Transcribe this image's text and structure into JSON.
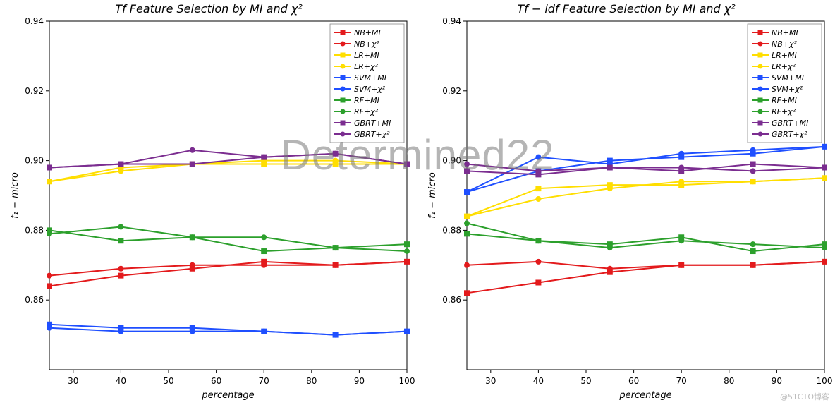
{
  "watermark": "Determined22",
  "footer_tag": "@51CTO博客",
  "chart_data": [
    {
      "type": "line",
      "title": "Tf Feature Selection by MI and χ²",
      "xlabel": "percentage",
      "ylabel": "f₁ − micro",
      "xlim": [
        25,
        100
      ],
      "ylim": [
        0.84,
        0.94
      ],
      "xticks": [
        30,
        40,
        50,
        60,
        70,
        80,
        90,
        100
      ],
      "yticks": [
        0.86,
        0.88,
        0.9,
        0.92,
        0.94
      ],
      "x": [
        25,
        40,
        55,
        70,
        85,
        100
      ],
      "legend_position": "upper-right",
      "series": [
        {
          "name": "NB+MI",
          "marker": "s",
          "color": "#e31a1c",
          "values": [
            0.864,
            0.867,
            0.869,
            0.871,
            0.87,
            0.871
          ]
        },
        {
          "name": "NB+χ²",
          "marker": "o",
          "color": "#e31a1c",
          "values": [
            0.867,
            0.869,
            0.87,
            0.87,
            0.87,
            0.871
          ]
        },
        {
          "name": "LR+MI",
          "marker": "s",
          "color": "#ffde00",
          "values": [
            0.894,
            0.898,
            0.899,
            0.899,
            0.899,
            0.899
          ]
        },
        {
          "name": "LR+χ²",
          "marker": "o",
          "color": "#ffde00",
          "values": [
            0.894,
            0.897,
            0.899,
            0.9,
            0.9,
            0.899
          ]
        },
        {
          "name": "SVM+MI",
          "marker": "s",
          "color": "#1f4fff",
          "values": [
            0.853,
            0.852,
            0.852,
            0.851,
            0.85,
            0.851
          ]
        },
        {
          "name": "SVM+χ²",
          "marker": "o",
          "color": "#1f4fff",
          "values": [
            0.852,
            0.851,
            0.851,
            0.851,
            0.85,
            0.851
          ]
        },
        {
          "name": "RF+MI",
          "marker": "s",
          "color": "#2ca02c",
          "values": [
            0.88,
            0.877,
            0.878,
            0.874,
            0.875,
            0.876
          ]
        },
        {
          "name": "RF+χ²",
          "marker": "o",
          "color": "#2ca02c",
          "values": [
            0.879,
            0.881,
            0.878,
            0.878,
            0.875,
            0.874
          ]
        },
        {
          "name": "GBRT+MI",
          "marker": "s",
          "color": "#7b2d90",
          "values": [
            0.898,
            0.899,
            0.899,
            0.901,
            0.902,
            0.899
          ]
        },
        {
          "name": "GBRT+χ²",
          "marker": "o",
          "color": "#7b2d90",
          "values": [
            0.898,
            0.899,
            0.903,
            0.901,
            0.902,
            0.899
          ]
        }
      ]
    },
    {
      "type": "line",
      "title": "Tf − idf Feature Selection by MI and χ²",
      "xlabel": "percentage",
      "ylabel": "f₁ − micro",
      "xlim": [
        25,
        100
      ],
      "ylim": [
        0.84,
        0.94
      ],
      "xticks": [
        30,
        40,
        50,
        60,
        70,
        80,
        90,
        100
      ],
      "yticks": [
        0.86,
        0.88,
        0.9,
        0.92,
        0.94
      ],
      "x": [
        25,
        40,
        55,
        70,
        85,
        100
      ],
      "legend_position": "upper-right",
      "series": [
        {
          "name": "NB+MI",
          "marker": "s",
          "color": "#e31a1c",
          "values": [
            0.862,
            0.865,
            0.868,
            0.87,
            0.87,
            0.871
          ]
        },
        {
          "name": "NB+χ²",
          "marker": "o",
          "color": "#e31a1c",
          "values": [
            0.87,
            0.871,
            0.869,
            0.87,
            0.87,
            0.871
          ]
        },
        {
          "name": "LR+MI",
          "marker": "s",
          "color": "#ffde00",
          "values": [
            0.884,
            0.892,
            0.893,
            0.893,
            0.894,
            0.895
          ]
        },
        {
          "name": "LR+χ²",
          "marker": "o",
          "color": "#ffde00",
          "values": [
            0.884,
            0.889,
            0.892,
            0.894,
            0.894,
            0.895
          ]
        },
        {
          "name": "SVM+MI",
          "marker": "s",
          "color": "#1f4fff",
          "values": [
            0.891,
            0.897,
            0.9,
            0.901,
            0.902,
            0.904
          ]
        },
        {
          "name": "SVM+χ²",
          "marker": "o",
          "color": "#1f4fff",
          "values": [
            0.891,
            0.901,
            0.899,
            0.902,
            0.903,
            0.904
          ]
        },
        {
          "name": "RF+MI",
          "marker": "s",
          "color": "#2ca02c",
          "values": [
            0.879,
            0.877,
            0.876,
            0.878,
            0.874,
            0.876
          ]
        },
        {
          "name": "RF+χ²",
          "marker": "o",
          "color": "#2ca02c",
          "values": [
            0.882,
            0.877,
            0.875,
            0.877,
            0.876,
            0.875
          ]
        },
        {
          "name": "GBRT+MI",
          "marker": "s",
          "color": "#7b2d90",
          "values": [
            0.897,
            0.896,
            0.898,
            0.897,
            0.899,
            0.898
          ]
        },
        {
          "name": "GBRT+χ²",
          "marker": "o",
          "color": "#7b2d90",
          "values": [
            0.899,
            0.897,
            0.898,
            0.898,
            0.897,
            0.898
          ]
        }
      ]
    }
  ]
}
